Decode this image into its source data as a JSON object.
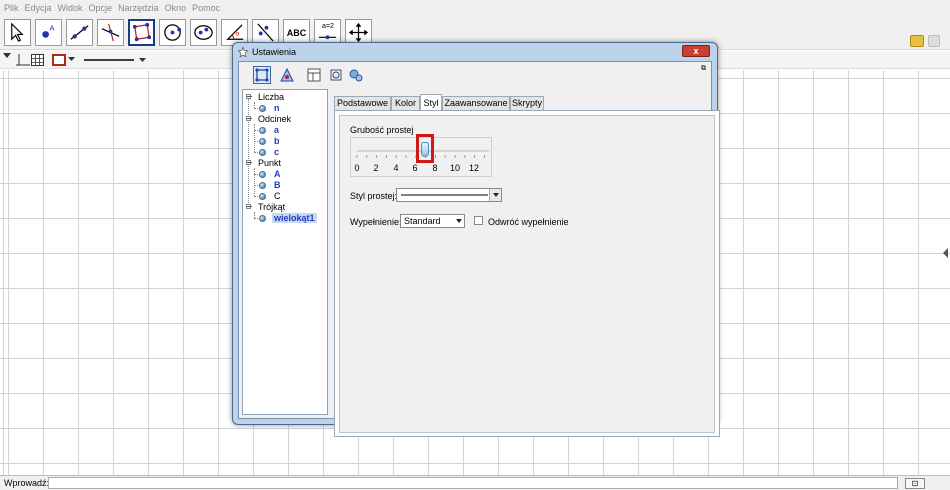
{
  "menu": [
    "Plik",
    "Edycja",
    "Widok",
    "Opcje",
    "Narzędzia",
    "Okno",
    "Pomoc"
  ],
  "toolbar": {
    "tools": [
      "move",
      "point",
      "line",
      "perpendicular-line",
      "polygon",
      "circle",
      "ellipse",
      "angle",
      "reflect",
      "text",
      "slider",
      "move-graphics-view"
    ],
    "selected_tool": "polygon",
    "text_tool_label": "ABC",
    "slider_tool_label": "a=2"
  },
  "dialog": {
    "title": "Ustawienia",
    "close_label": "x",
    "tree": {
      "groups": [
        {
          "label": "Liczba",
          "items": [
            "n"
          ]
        },
        {
          "label": "Odcinek",
          "items": [
            "a",
            "b",
            "c"
          ]
        },
        {
          "label": "Punkt",
          "items": [
            "A",
            "B",
            "C"
          ]
        },
        {
          "label": "Trójkąt",
          "items": [
            "wielokąt1"
          ]
        }
      ],
      "selected": "wielokąt1"
    },
    "tabs": [
      "Podstawowe",
      "Kolor",
      "Styl",
      "Zaawansowane",
      "Skrypty"
    ],
    "active_tab": "Styl",
    "style": {
      "line_thickness_title": "Grubość prostej",
      "slider_ticks": [
        "0",
        "2",
        "4",
        "6",
        "8",
        "10",
        "12"
      ],
      "slider_value": 7,
      "line_style_label": "Styl prostej:",
      "fill_label": "Wypełnienie:",
      "fill_value": "Standard",
      "inverse_fill_label": "Odwróć wypełnienie",
      "inverse_fill_checked": false
    }
  },
  "input_bar": {
    "label": "Wprowadź:",
    "value": ""
  },
  "colors": {
    "dialog_frame": "#bcd3ea",
    "highlight": "#d01818",
    "tree_leaf": "#1f3cc2",
    "close_button": "#c84031"
  }
}
